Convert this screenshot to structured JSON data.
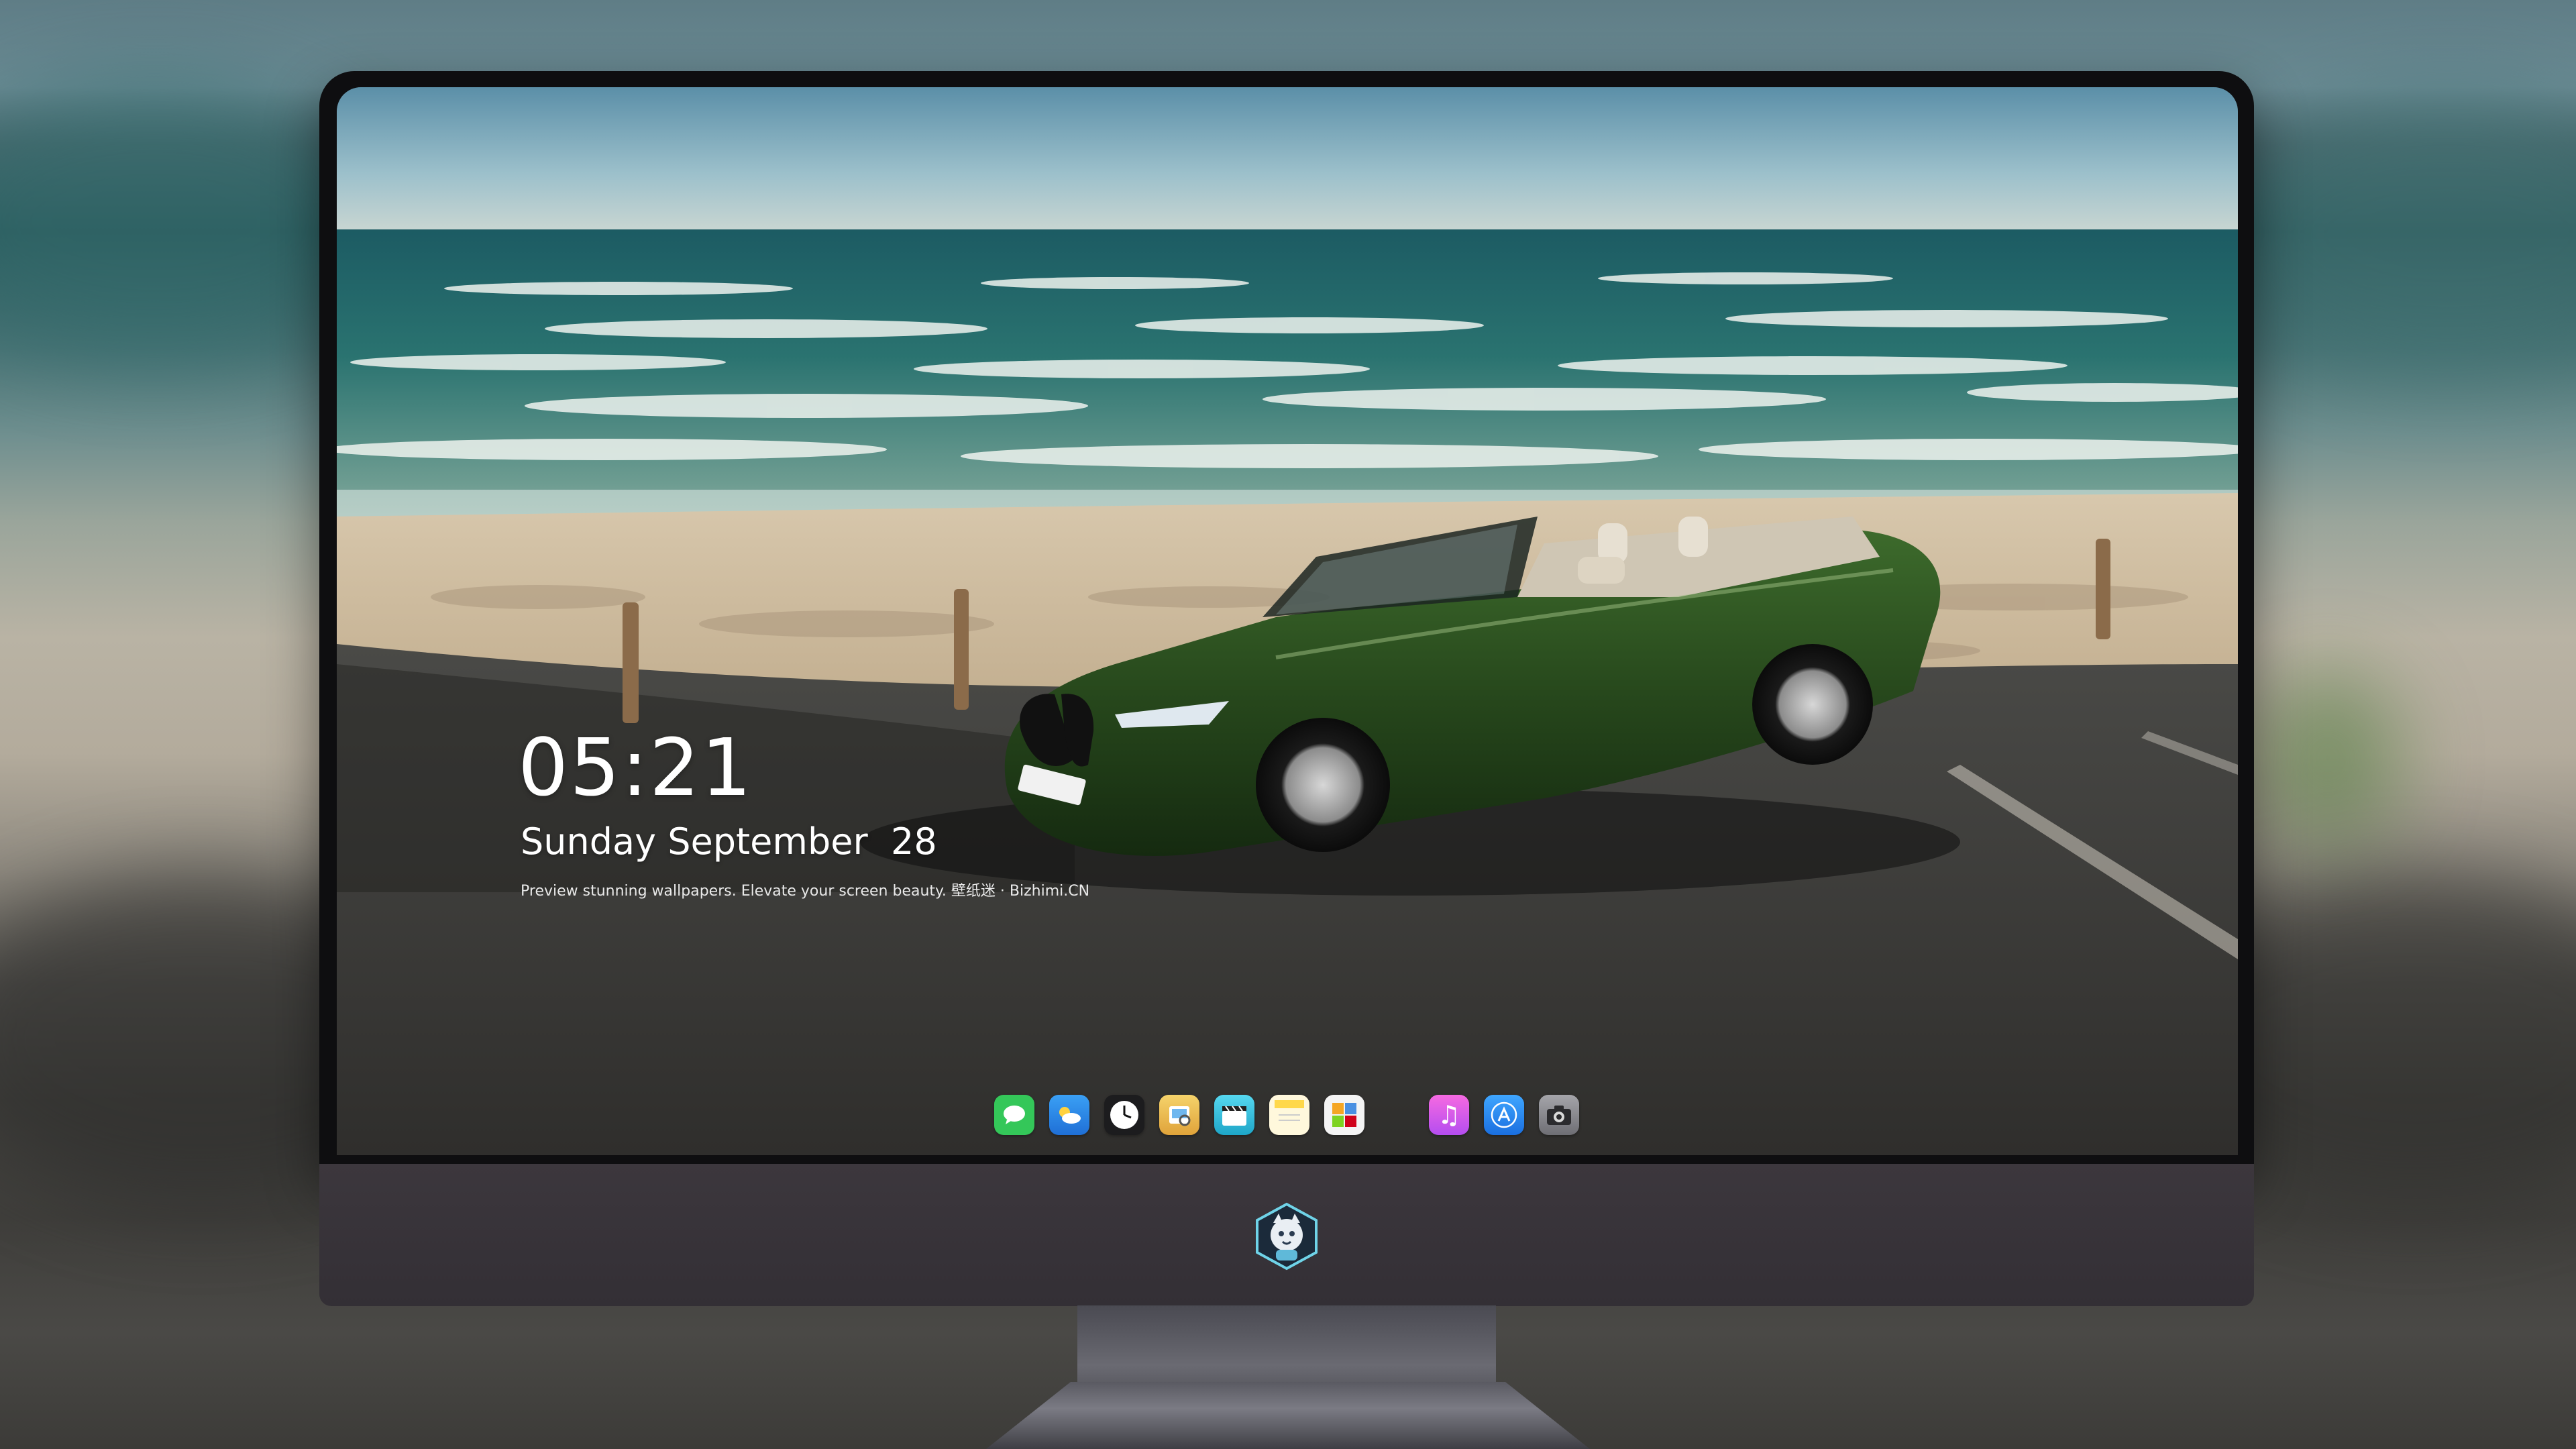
{
  "lock_screen": {
    "time": "05:21",
    "date": "Sunday September  28",
    "caption": "Preview stunning wallpapers. Elevate your screen beauty. 壁纸迷 · Bizhimi.CN"
  },
  "dock": {
    "apps": [
      {
        "name": "messages-icon",
        "color": "#34c759"
      },
      {
        "name": "weather-icon",
        "color": "#2f8cf0"
      },
      {
        "name": "clock-icon",
        "color": "#1c1c1e"
      },
      {
        "name": "preview-icon",
        "color": "#e9b949"
      },
      {
        "name": "clips-icon",
        "color": "#3ec6e0"
      },
      {
        "name": "notes-icon",
        "color": "#ffd84a"
      },
      {
        "name": "photo-booth-icon",
        "color": "#f4f4f4"
      },
      {
        "name": "itunes-icon",
        "color": "#e94bd1"
      },
      {
        "name": "app-store-icon",
        "color": "#2a8cf5"
      },
      {
        "name": "camera-icon",
        "color": "#8d8d92"
      }
    ]
  },
  "monitor": {
    "logo": "mascot-logo-icon"
  }
}
